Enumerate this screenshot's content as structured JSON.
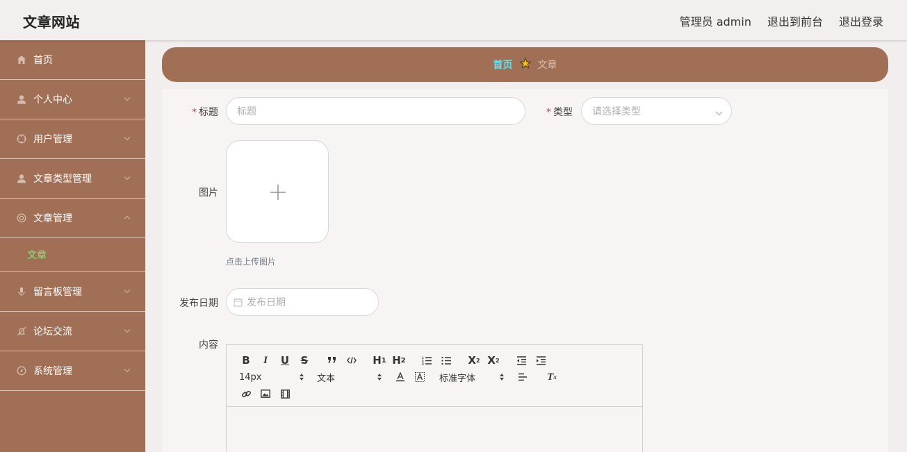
{
  "header": {
    "site_title": "文章网站",
    "admin_label": "管理员 admin",
    "to_front_label": "退出到前台",
    "logout_label": "退出登录"
  },
  "sidebar": {
    "items": [
      {
        "label": "首页",
        "icon": "home-icon"
      },
      {
        "label": "个人中心",
        "icon": "user-icon"
      },
      {
        "label": "用户管理",
        "icon": "target-icon"
      },
      {
        "label": "文章类型管理",
        "icon": "user-icon"
      },
      {
        "label": "文章管理",
        "icon": "lifebuoy-icon",
        "expanded": true,
        "children": [
          {
            "label": "文章",
            "active": true
          }
        ]
      },
      {
        "label": "留言板管理",
        "icon": "microphone-icon"
      },
      {
        "label": "论坛交流",
        "icon": "notification-off-icon"
      },
      {
        "label": "系统管理",
        "icon": "compass-icon"
      }
    ]
  },
  "breadcrumb": {
    "home": "首页",
    "current": "文章",
    "separator_icon": "star-icon"
  },
  "form": {
    "title_label": "标题",
    "title_placeholder": "标题",
    "type_label": "类型",
    "type_placeholder": "请选择类型",
    "image_label": "图片",
    "upload_hint": "点击上传图片",
    "date_label": "发布日期",
    "date_placeholder": "发布日期",
    "content_label": "内容"
  },
  "editor": {
    "font_size": "14px",
    "header_select": "文本",
    "font_family": "标准字体",
    "sub_label": "X",
    "sub_script": "2",
    "sup_label": "X",
    "sup_script": "2"
  },
  "colors": {
    "sidebar_bg": "#a06f55",
    "accent_active": "#7cf07c",
    "breadcrumb_home": "#67e2ee",
    "required": "#e23b3b"
  }
}
